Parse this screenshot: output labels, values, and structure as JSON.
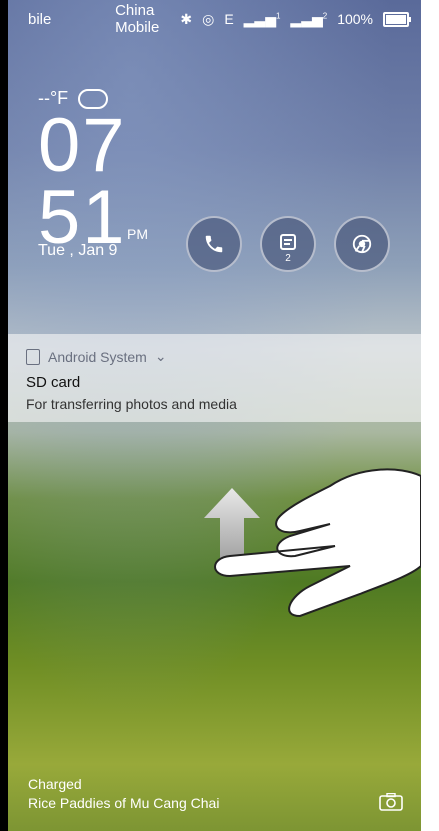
{
  "status_bar": {
    "left_text": "bile",
    "carrier": "China Mobile",
    "signal1_label": "1",
    "signal2_label": "2",
    "battery": "100%"
  },
  "weather": {
    "temp": "--°F"
  },
  "clock": {
    "hour": "07",
    "minute": "51",
    "ampm": "PM",
    "date": "Tue , Jan 9"
  },
  "shortcuts": {
    "phone": {
      "icon": "phone-icon"
    },
    "messages": {
      "icon": "message-icon",
      "badge": "2"
    },
    "chrome": {
      "icon": "chrome-icon"
    }
  },
  "notification": {
    "app_name": "Android System",
    "title": "SD card",
    "body": "For transferring photos and media"
  },
  "footer": {
    "status": "Charged",
    "wallpaper_name": "Rice Paddies of Mu Cang Chai"
  }
}
